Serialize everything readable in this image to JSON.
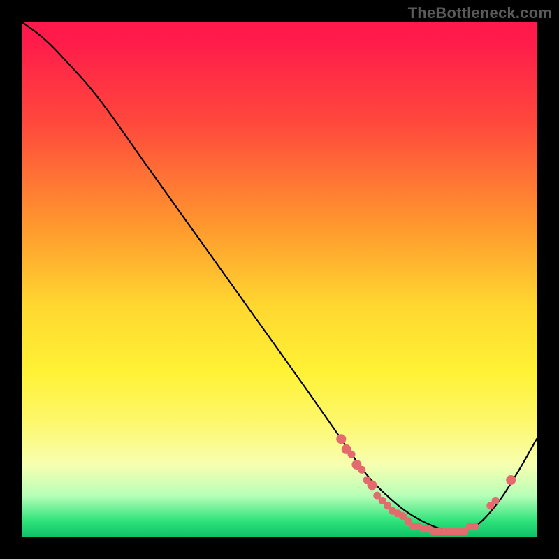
{
  "watermark": "TheBottleneck.com",
  "chart_data": {
    "type": "line",
    "title": "",
    "xlabel": "",
    "ylabel": "",
    "xlim": [
      0,
      100
    ],
    "ylim": [
      0,
      100
    ],
    "grid": false,
    "series": [
      {
        "name": "bottleneck-curve",
        "color": "#000000",
        "x": [
          0,
          4,
          8,
          15,
          25,
          35,
          45,
          55,
          62,
          67,
          72,
          76,
          80,
          84,
          88,
          92,
          96,
          100
        ],
        "y": [
          100,
          97,
          93,
          85,
          71,
          57,
          43,
          29,
          19,
          12,
          7,
          4,
          2,
          1,
          2,
          6,
          12,
          19
        ]
      }
    ],
    "markers": {
      "name": "highlight-points",
      "color": "#e46a6d",
      "points": [
        {
          "x": 62,
          "y": 19,
          "r": 1.4
        },
        {
          "x": 63,
          "y": 17,
          "r": 1.4
        },
        {
          "x": 64,
          "y": 16,
          "r": 1.1
        },
        {
          "x": 65,
          "y": 14,
          "r": 1.4
        },
        {
          "x": 66,
          "y": 13,
          "r": 1.1
        },
        {
          "x": 67,
          "y": 11,
          "r": 1.1
        },
        {
          "x": 68,
          "y": 10,
          "r": 1.4
        },
        {
          "x": 69,
          "y": 8,
          "r": 1.1
        },
        {
          "x": 70,
          "y": 7,
          "r": 1.1
        },
        {
          "x": 71,
          "y": 6,
          "r": 1.1
        },
        {
          "x": 72,
          "y": 5,
          "r": 1.1
        },
        {
          "x": 73,
          "y": 4.5,
          "r": 1.1
        },
        {
          "x": 74,
          "y": 4,
          "r": 1.1
        },
        {
          "x": 75,
          "y": 3,
          "r": 1.1
        },
        {
          "x": 76,
          "y": 2,
          "r": 1.1
        },
        {
          "x": 77,
          "y": 2,
          "r": 1.1
        },
        {
          "x": 78,
          "y": 1.5,
          "r": 1.1
        },
        {
          "x": 79,
          "y": 1.5,
          "r": 1.1
        },
        {
          "x": 80,
          "y": 1,
          "r": 1.1
        },
        {
          "x": 81,
          "y": 1,
          "r": 1.1
        },
        {
          "x": 82,
          "y": 1,
          "r": 1.1
        },
        {
          "x": 83,
          "y": 1,
          "r": 1.1
        },
        {
          "x": 84,
          "y": 1,
          "r": 1.1
        },
        {
          "x": 85,
          "y": 1,
          "r": 1.1
        },
        {
          "x": 86,
          "y": 1,
          "r": 1.1
        },
        {
          "x": 87,
          "y": 2,
          "r": 1.1
        },
        {
          "x": 88,
          "y": 2,
          "r": 1.1
        },
        {
          "x": 91,
          "y": 6,
          "r": 1.1
        },
        {
          "x": 92,
          "y": 7,
          "r": 1.1
        },
        {
          "x": 95,
          "y": 11,
          "r": 1.4
        }
      ]
    }
  }
}
